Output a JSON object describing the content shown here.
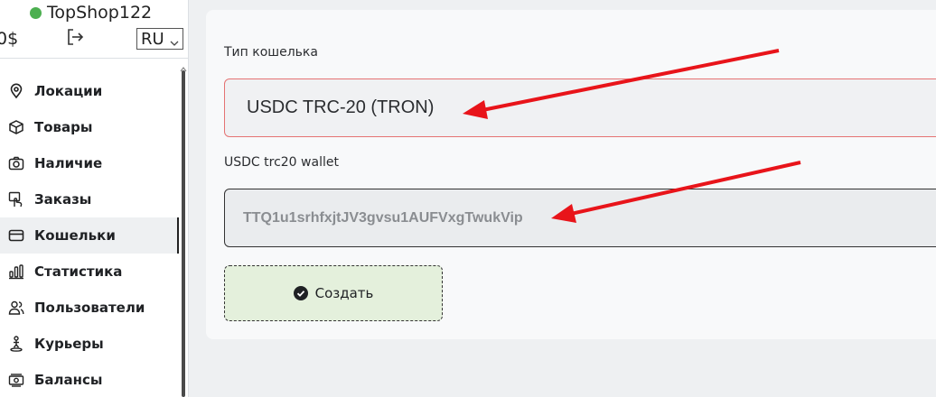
{
  "header": {
    "shop_name": "TopShop122",
    "status_color": "#4caf50",
    "balance": "0$",
    "language": "RU"
  },
  "sidebar": {
    "items": [
      {
        "label": "Локации",
        "icon": "map-pin-icon"
      },
      {
        "label": "Товары",
        "icon": "box-icon"
      },
      {
        "label": "Наличие",
        "icon": "camera-icon"
      },
      {
        "label": "Заказы",
        "icon": "hand-pointer-icon"
      },
      {
        "label": "Кошельки",
        "icon": "wallet-card-icon",
        "active": true
      },
      {
        "label": "Статистика",
        "icon": "bar-chart-icon"
      },
      {
        "label": "Пользователи",
        "icon": "users-icon"
      },
      {
        "label": "Курьеры",
        "icon": "courier-icon"
      },
      {
        "label": "Балансы",
        "icon": "money-icon"
      }
    ]
  },
  "form": {
    "wallet_type_label": "Тип кошелька",
    "wallet_type_value": "USDC TRC-20 (TRON)",
    "wallet_label": "USDC trc20 wallet",
    "wallet_value": "TTQ1u1srhfxjtJV3gvsu1AUFVxgTwukVip",
    "submit_label": "Создать"
  },
  "colors": {
    "accent_arrow": "#e8141a",
    "active_item_bg": "#eef0f2",
    "submit_bg": "#e4f0dc",
    "select_border": "#e57373"
  }
}
